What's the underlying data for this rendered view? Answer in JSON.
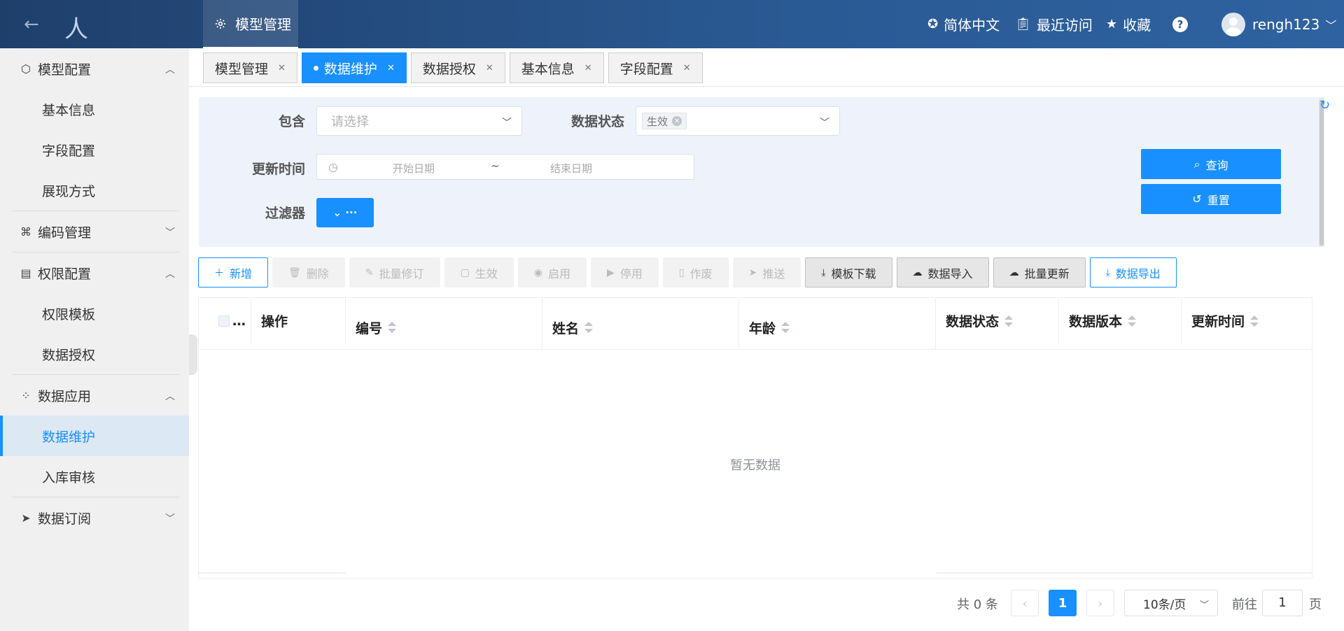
{
  "header": {
    "back_icon": "arrow-left-icon",
    "logo_text": "人",
    "module": {
      "label": "模型管理",
      "icon": "gear-icon"
    },
    "language": {
      "label": "简体中文",
      "icon": "globe-icon"
    },
    "recent": {
      "label": "最近访问",
      "icon": "clipboard-icon"
    },
    "favorites": {
      "label": "收藏",
      "icon": "star-icon"
    },
    "help": {
      "label": "?",
      "icon": "help-icon"
    },
    "user": {
      "name": "rengh123",
      "icon": "avatar"
    }
  },
  "sidebar": {
    "groups": [
      {
        "label": "模型配置",
        "icon": "cube-icon",
        "expanded": true,
        "items": [
          "基本信息",
          "字段配置",
          "展现方式"
        ]
      },
      {
        "label": "编码管理",
        "icon": "code-icon",
        "expanded": false,
        "items": []
      },
      {
        "label": "权限配置",
        "icon": "permission-icon",
        "expanded": true,
        "items": [
          "权限模板",
          "数据授权"
        ]
      },
      {
        "label": "数据应用",
        "icon": "grid-icon",
        "expanded": true,
        "items": [
          "数据维护",
          "入库审核"
        ]
      },
      {
        "label": "数据订阅",
        "icon": "send-icon",
        "expanded": false,
        "items": []
      }
    ],
    "active_item": "数据维护"
  },
  "tabs": [
    {
      "label": "模型管理",
      "active": false
    },
    {
      "label": "数据维护",
      "active": true
    },
    {
      "label": "数据授权",
      "active": false
    },
    {
      "label": "基本信息",
      "active": false
    },
    {
      "label": "字段配置",
      "active": false
    }
  ],
  "search": {
    "contain": {
      "label": "包含",
      "placeholder": "请选择"
    },
    "status": {
      "label": "数据状态",
      "tag": "生效"
    },
    "update_time": {
      "label": "更新时间",
      "start_placeholder": "开始日期",
      "separator": "~",
      "end_placeholder": "结束日期"
    },
    "filter": {
      "label": "过滤器",
      "button_text": "⌄ ···"
    },
    "query_button": "查询",
    "reset_button": "重置"
  },
  "toolbar": {
    "add": "新增",
    "delete": "删除",
    "batch_revise": "批量修订",
    "effective": "生效",
    "enable": "启用",
    "disable": "停用",
    "void": "作废",
    "push": "推送",
    "template_download": "模板下载",
    "data_import": "数据导入",
    "batch_update": "批量更新",
    "data_export": "数据导出"
  },
  "table": {
    "select_all_label": "…",
    "columns": [
      "操作",
      "编号",
      "姓名",
      "年龄",
      "数据状态",
      "数据版本",
      "更新时间"
    ],
    "rows": [],
    "empty_text": "暂无数据"
  },
  "pagination": {
    "total_text": "共 0 条",
    "prev_icon": "chevron-left-icon",
    "current_page": "1",
    "next_icon": "chevron-right-icon",
    "page_size": "10条/页",
    "goto_label": "前往",
    "goto_value": "1",
    "page_label": "页"
  }
}
